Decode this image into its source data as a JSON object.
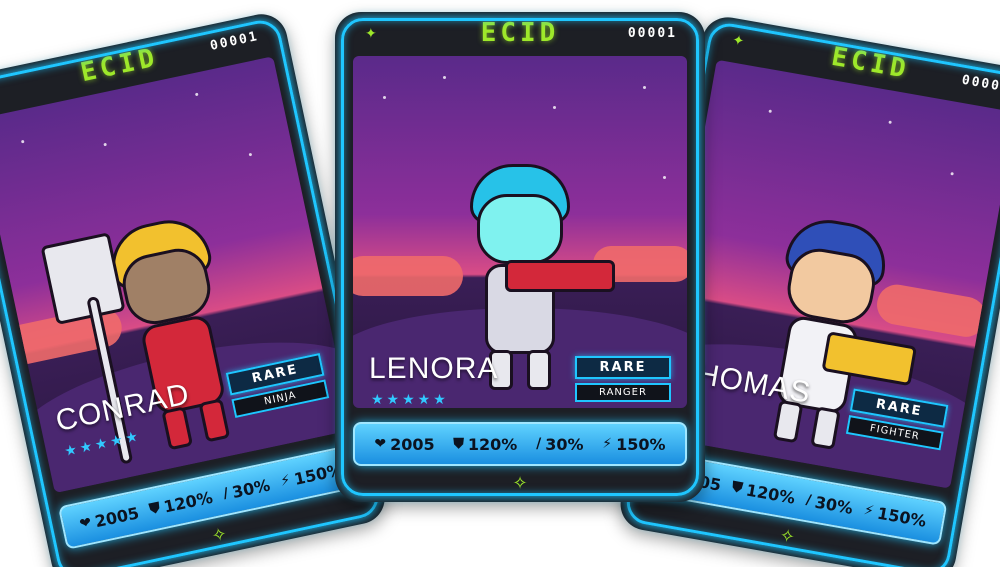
{
  "cards": [
    {
      "position": "left",
      "logo": "ECID",
      "serial": "00001",
      "name": "CONRAD",
      "stars": "★★★★★",
      "rarity": "RARE",
      "class": "NINJA",
      "stats": {
        "hp": "2005",
        "defense": "120%",
        "attack": "30%",
        "speed": "150%"
      },
      "colors": {
        "hair": "#f2c12e",
        "suit": "#d3283a"
      }
    },
    {
      "position": "center",
      "logo": "ECID",
      "serial": "00001",
      "name": "LENORA",
      "stars": "★★★★★",
      "rarity": "RARE",
      "class": "RANGER",
      "stats": {
        "hp": "2005",
        "defense": "120%",
        "attack": "30%",
        "speed": "150%"
      },
      "colors": {
        "hair": "#27c2e8",
        "suit": "#d9d9e4"
      }
    },
    {
      "position": "right",
      "logo": "ECID",
      "serial": "00001",
      "name": "THOMAS",
      "stars": "★★★★★",
      "rarity": "RARE",
      "class": "FIGHTER",
      "stats": {
        "hp": "2005",
        "defense": "120%",
        "attack": "30%",
        "speed": "150%"
      },
      "colors": {
        "hair": "#2f4fb8",
        "suit": "#f2f2f6"
      }
    }
  ],
  "icons": {
    "hp": "heart-icon",
    "defense": "shield-icon",
    "attack": "sword-icon",
    "speed": "lightning-icon"
  }
}
